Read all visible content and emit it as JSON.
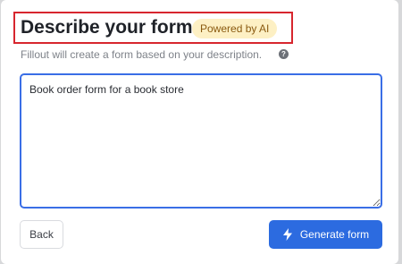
{
  "dialog": {
    "title": "Describe your form",
    "badge": "Powered by AI",
    "subtitle": "Fillout will create a form based on your description.",
    "help_icon": "question-circle-icon",
    "help_glyph": "?",
    "description_value": "Book order form for a book store",
    "back_label": "Back",
    "generate_label": "Generate form",
    "generate_icon": "lightning-bolt-icon"
  },
  "colors": {
    "accent": "#2c6be0",
    "highlight_border": "#d7262e",
    "badge_bg": "#fdf0c4",
    "badge_text": "#8a5a10"
  }
}
